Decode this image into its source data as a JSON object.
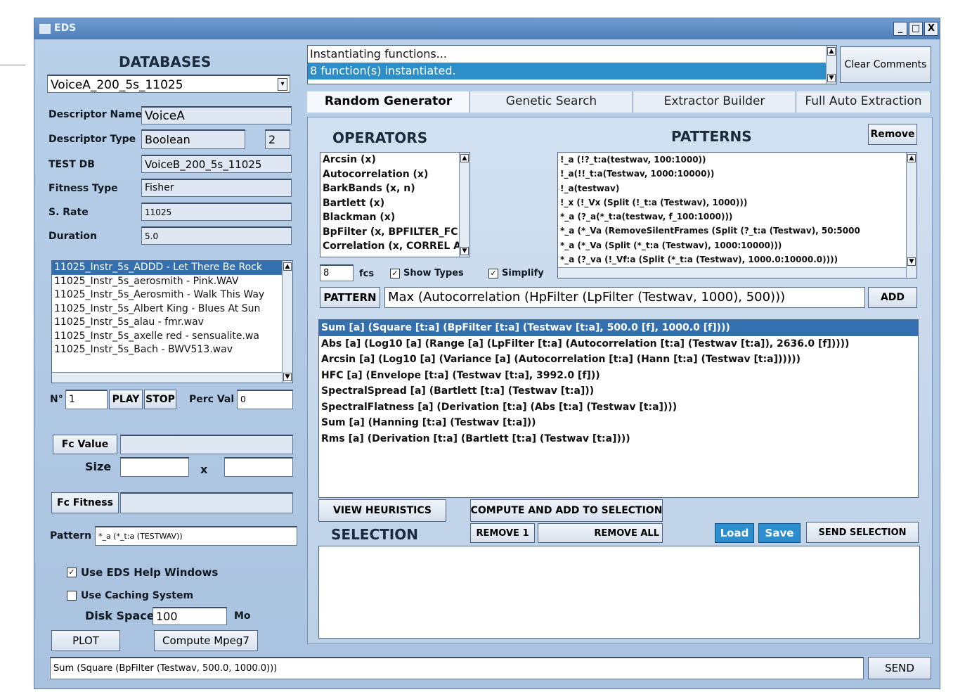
{
  "window": {
    "title": "EDS",
    "controls": [
      "_",
      "□",
      "X"
    ]
  },
  "left": {
    "databases_title": "DATABASES",
    "database_select": "VoiceA_200_5s_11025",
    "descriptor_name": {
      "label": "Descriptor Name",
      "value": "VoiceA"
    },
    "descriptor_type": {
      "label": "Descriptor Type",
      "value": "Boolean",
      "extra": "2"
    },
    "test_db": {
      "label": "TEST DB",
      "value": "VoiceB_200_5s_11025"
    },
    "fitness_type": {
      "label": "Fitness Type",
      "value": "Fisher"
    },
    "s_rate": {
      "label": "S. Rate",
      "value": "11025"
    },
    "duration": {
      "label": "Duration",
      "value": "5.0"
    },
    "files": [
      "11025_Instr_5s_ADDD - Let There Be Rock",
      "11025_Instr_5s_aerosmith - Pink.WAV",
      "11025_Instr_5s_Aerosmith - Walk This Way",
      "11025_Instr_5s_Albert King - Blues At Sun",
      "11025_Instr_5s_alau - fmr.wav",
      "11025_Instr_5s_axelle red - sensualite.wa",
      "11025_Instr_5s_Bach - BWV513.wav"
    ],
    "n_label": "N°",
    "n_value": "1",
    "play": "PLAY",
    "stop": "STOP",
    "perc_val_label": "Perc Val",
    "perc_val_value": "0",
    "fc_value_btn": "Fc Value",
    "size_label": "Size",
    "size_x": "x",
    "fc_fitness_btn": "Fc Fitness",
    "pattern_label": "Pattern",
    "pattern_value": "*_a (*_t:a (TESTWAV))",
    "use_help": "Use EDS Help Windows",
    "use_caching": "Use Caching System",
    "disk_space_label": "Disk Space",
    "disk_space_value": "100",
    "disk_unit": "Mo",
    "plot": "PLOT",
    "compute_mpeg7": "Compute Mpeg7"
  },
  "comments": {
    "lines": [
      "Instantiating functions...",
      "8 function(s) instantiated."
    ],
    "clear": "Clear Comments"
  },
  "tabs": [
    "Random Generator",
    "Genetic Search",
    "Extractor Builder",
    "Full Auto Extraction"
  ],
  "operators": {
    "title": "OPERATORS",
    "items": [
      "Arcsin (x)",
      "Autocorrelation (x)",
      "BarkBands (x, n)",
      "Bartlett (x)",
      "Blackman (x)",
      "BpFilter (x, BPFILTER_FC",
      "Correlation (x, CORREL A"
    ],
    "count": "8",
    "fcs": "fcs",
    "show_types": "Show Types",
    "simplify": "Simplify"
  },
  "patterns": {
    "title": "PATTERNS",
    "remove": "Remove",
    "items": [
      "!_a (!?_t:a(testwav, 100:1000))",
      "!_a(!!_t:a(Testwav, 1000:10000))",
      "!_a(testwav)",
      "!_x (!_Vx (Split (!_t:a (Testwav), 1000)))",
      "*_a (?_a(*_t:a(testwav, f_100:1000)))",
      "*_a (*_Va (RemoveSilentFrames (Split (?_t:a (Testwav), 50:5000",
      "*_a (*_Va (Split (*_t:a (Testwav), 1000:10000)))",
      "*_a (?_va (!_Vf:a (Split (*_t:a (Testwav), 1000.0:10000.0))))"
    ]
  },
  "pattern_bar": {
    "button": "PATTERN",
    "value": "Max (Autocorrelation (HpFilter (LpFilter (Testwav, 1000), 500)))",
    "add": "ADD"
  },
  "results": [
    "Sum [a] (Square [t:a] (BpFilter [t:a] (Testwav [t:a], 500.0 [f], 1000.0 [f])))",
    "Abs [a] (Log10 [a] (Range [a] (LpFilter [t:a] (Autocorrelation [t:a] (Testwav [t:a]), 2636.0 [f]))))",
    "Arcsin [a] (Log10 [a] (Variance [a] (Autocorrelation [t:a] (Hann [t:a] (Testwav [t:a])))))",
    "HFC [a] (Envelope [t:a] (Testwav [t:a], 3992.0 [f]))",
    "SpectralSpread [a] (Bartlett [t:a] (Testwav [t:a]))",
    "SpectralFlatness [a] (Derivation [t:a] (Abs [t:a] (Testwav [t:a])))",
    "Sum [a] (Hanning [t:a] (Testwav [t:a]))",
    "Rms [a] (Derivation [t:a] (Bartlett [t:a] (Testwav [t:a])))"
  ],
  "actions": {
    "view_heuristics": "VIEW HEURISTICS",
    "compute_add": "COMPUTE AND ADD TO SELECTION",
    "remove_1": "REMOVE 1",
    "remove_all": "REMOVE ALL",
    "selection_title": "SELECTION",
    "load": "Load",
    "save": "Save",
    "send_selection": "SEND SELECTION"
  },
  "bottom": {
    "command": "Sum (Square (BpFilter (Testwav, 500.0, 1000.0)))",
    "send": "SEND"
  },
  "colors": {
    "window_bg": "#b9d0e9",
    "titlebar": "#4f7fb8",
    "selection_blue": "#3470b0",
    "button_blue": "#2c8ecf"
  }
}
